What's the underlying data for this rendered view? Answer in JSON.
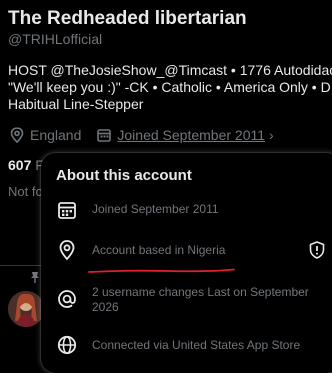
{
  "profile": {
    "display_name": "The Redheaded libertarian",
    "handle": "@TRIHLofficial",
    "bio_lines": [
      "HOST @TheJosieShow_@Timcast • 1776 Autodidac",
      "\"We'll keep you :)\" -CK • Catholic • America Only • D",
      "Habitual Line-Stepper"
    ],
    "location": "England",
    "joined": "Joined September 2011",
    "following_count": "607",
    "following_label_partial": "F",
    "not_followed_partial": "Not fo"
  },
  "about_popover": {
    "title": "About this account",
    "rows": [
      {
        "icon": "calendar-icon",
        "text": "Joined September 2011"
      },
      {
        "icon": "location-pin-icon",
        "text": "Account based in Nigeria"
      },
      {
        "icon": "at-sign-icon",
        "text": "2 username changes Last on September 2026"
      },
      {
        "icon": "globe-icon",
        "text": "Connected via United States App Store"
      }
    ]
  },
  "colors": {
    "background": "#000000",
    "primary_text": "#e7e9ea",
    "secondary_text": "#71767b",
    "annotation_red": "#e0202a"
  }
}
